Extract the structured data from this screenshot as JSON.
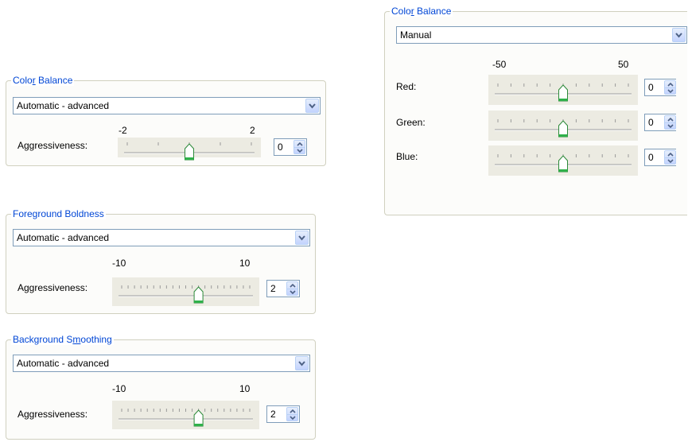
{
  "color_balance_auto": {
    "title_pre": "Colo",
    "title_key": "r",
    "title_post": " Balance",
    "mode": "Automatic - advanced",
    "min_label": "-2",
    "max_label": "2",
    "label": "Aggressiveness:",
    "min": -2,
    "max": 2,
    "value": 0,
    "value_text": "0"
  },
  "foreground_boldness": {
    "title": "Foreground Boldness",
    "mode": "Automatic - advanced",
    "min_label": "-10",
    "max_label": "10",
    "label": "Aggressiveness:",
    "min": -10,
    "max": 10,
    "value": 2,
    "value_text": "2"
  },
  "background_smoothing": {
    "title_pre": "Background S",
    "title_key": "m",
    "title_post": "oothing",
    "mode": "Automatic - advanced",
    "min_label": "-10",
    "max_label": "10",
    "label": "Aggressiveness:",
    "min": -10,
    "max": 10,
    "value": 2,
    "value_text": "2"
  },
  "color_balance_manual": {
    "title_pre": "Colo",
    "title_key": "r",
    "title_post": " Balance",
    "mode": "Manual",
    "min_label": "-50",
    "max_label": "50",
    "channels": [
      {
        "label": "Red:",
        "min": -50,
        "max": 50,
        "value": 0,
        "value_text": "0"
      },
      {
        "label": "Green:",
        "min": -50,
        "max": 50,
        "value": 0,
        "value_text": "0"
      },
      {
        "label": "Blue:",
        "min": -50,
        "max": 50,
        "value": 0,
        "value_text": "0"
      }
    ]
  },
  "colors": {
    "group_title": "#0046d5",
    "thumb_fill": "#ffffff",
    "thumb_edge": "#2c8a39",
    "thumb_base": "#2fb14a"
  },
  "icons": {
    "dropdown": "chevron-down-icon",
    "spin_up": "spin-up-arrow-icon",
    "spin_down": "spin-down-arrow-icon",
    "thumb": "slider-thumb-icon"
  }
}
